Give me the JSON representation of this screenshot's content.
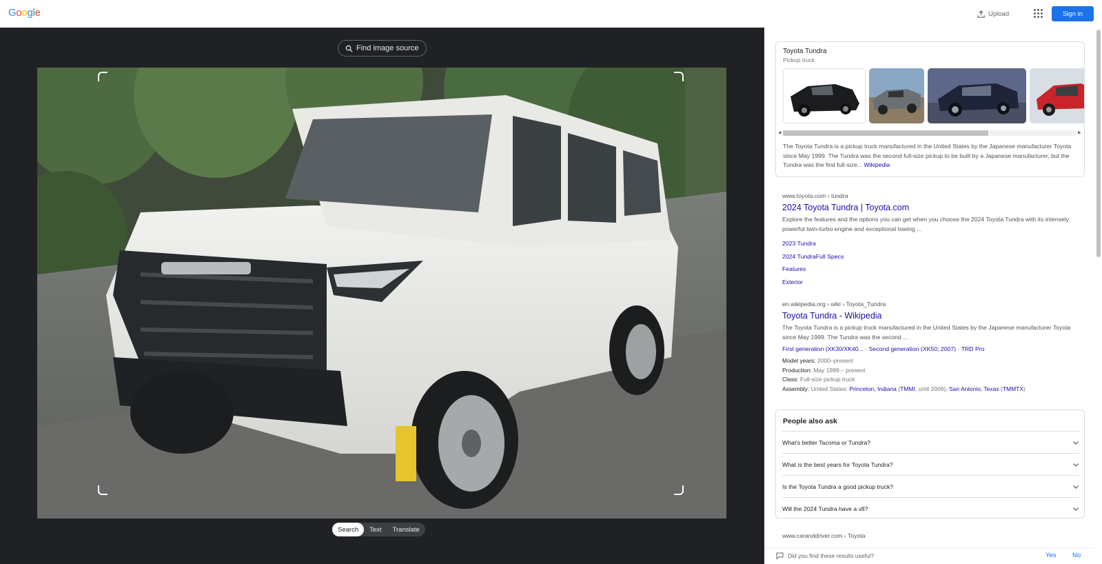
{
  "header": {
    "logo_text": "Google",
    "upload_label": "Upload",
    "signin_label": "Sign in",
    "brand_color": "#1a73e8"
  },
  "viewer": {
    "find_source_label": "Find image source",
    "tabs": [
      {
        "label": "Search",
        "active": true
      },
      {
        "label": "Text",
        "active": false
      },
      {
        "label": "Translate",
        "active": false
      }
    ],
    "image_subject": "white pickup truck parked on street"
  },
  "knowledge_panel": {
    "title": "Toyota Tundra",
    "subtitle": "Pickup truck",
    "thumbnails": [
      "black truck",
      "gray truck",
      "dark blue truck",
      "red truck"
    ],
    "description": "The Toyota Tundra is a pickup truck manufactured in the United States by the Japanese manufacturer Toyota since May 1999. The Tundra was the second full-size pickup to be built by a Japanese manufacturer, but the Tundra was the first full-size...",
    "source_link": "Wikipedia"
  },
  "results": [
    {
      "url": "www.toyota.com › tundra",
      "title": "2024 Toyota Tundra | Toyota.com",
      "snippet": "Explore the features and the options you can get when you choose the 2024 Toyota Tundra with its intensely powerful twin-turbo engine and exceptional towing ...",
      "sublinks": [
        "2023 Tundra",
        "2024 TundraFull Specs",
        "Features",
        "Exterior"
      ]
    },
    {
      "url": "en.wikipedia.org › wiki › Toyota_Tundra",
      "title": "Toyota Tundra - Wikipedia",
      "snippet": "The Toyota Tundra is a pickup truck manufactured in the United States by the Japanese manufacturer Toyota since May 1999. The Tundra was the second ...",
      "inline_links": [
        "First generation (XK30/XK40...",
        "Second generation (XK50; 2007)",
        "TRD Pro"
      ],
      "facts": {
        "model_years_label": "Model years:",
        "model_years_value": "2000–present",
        "production_label": "Production:",
        "production_value": "May 1999 – present",
        "class_label": "Class:",
        "class_value": "Full-size pickup truck",
        "assembly_label": "Assembly:",
        "assembly_prefix": "United States:",
        "assembly_link1": "Princeton, Indiana",
        "assembly_link2": "TMMI",
        "assembly_mid": ", until 2009);",
        "assembly_link3": "San Antonio, Texas",
        "assembly_link4": "TMMTX"
      }
    },
    {
      "url": "www.caranddriver.com › Toyota"
    }
  ],
  "people_also_ask": {
    "title": "People also ask",
    "questions": [
      "What's better Tacoma or Tundra?",
      "What is the best years for Toyota Tundra?",
      "Is the Toyota Tundra a good pickup truck?",
      "Will the 2024 Tundra have a v8?"
    ]
  },
  "feedback": {
    "question": "Did you find these results useful?",
    "yes": "Yes",
    "no": "No"
  }
}
